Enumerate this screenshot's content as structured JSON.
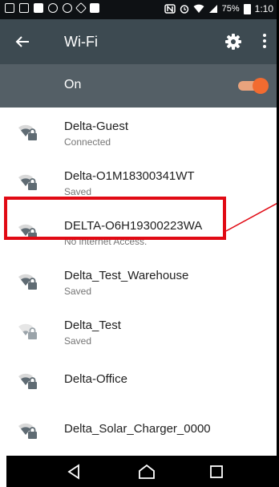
{
  "status_bar": {
    "battery": "75%",
    "time": "1:10"
  },
  "app_bar": {
    "title": "Wi-Fi",
    "back_icon": "arrow-left-icon",
    "settings_icon": "gear-icon",
    "overflow_icon": "more-vert-icon"
  },
  "toggle_row": {
    "label": "On",
    "state": "on",
    "accent": "#f26b30"
  },
  "networks": [
    {
      "ssid": "Delta-Guest",
      "status": "Connected"
    },
    {
      "ssid": "Delta-O1M18300341WT",
      "status": "Saved"
    },
    {
      "ssid": "DELTA-O6H19300223WA",
      "status": "No internet Access."
    },
    {
      "ssid": "Delta_Test_Warehouse",
      "status": "Saved"
    },
    {
      "ssid": "Delta_Test",
      "status": "Saved"
    },
    {
      "ssid": "Delta-Office",
      "status": ""
    },
    {
      "ssid": "Delta_Solar_Charger_0000",
      "status": ""
    }
  ],
  "annotation": {
    "color": "#e10a14"
  },
  "nav_bar": {
    "back": "triangle-back-icon",
    "home": "home-icon",
    "recents": "square-recents-icon"
  }
}
